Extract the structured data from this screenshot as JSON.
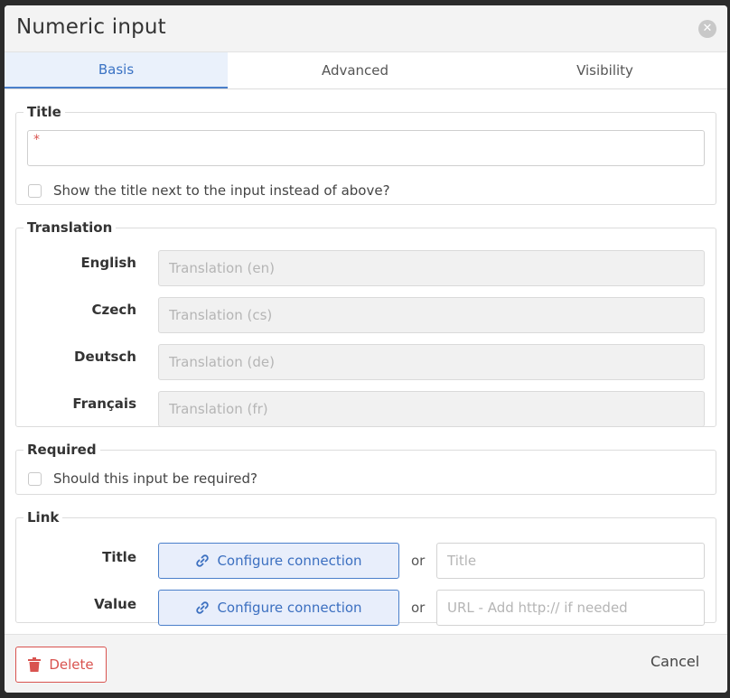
{
  "dialog": {
    "title": "Numeric input",
    "close_icon": "close-icon"
  },
  "tabs": [
    {
      "label": "Basis",
      "active": true
    },
    {
      "label": "Advanced",
      "active": false
    },
    {
      "label": "Visibility",
      "active": false
    }
  ],
  "title_section": {
    "legend": "Title",
    "required_marker": "*",
    "input_value": "",
    "checkbox_label": "Show the title next to the input instead of above?",
    "checked": false
  },
  "translation_section": {
    "legend": "Translation",
    "rows": [
      {
        "label": "English",
        "placeholder": "Translation (en)"
      },
      {
        "label": "Czech",
        "placeholder": "Translation (cs)"
      },
      {
        "label": "Deutsch",
        "placeholder": "Translation (de)"
      },
      {
        "label": "Français",
        "placeholder": "Translation (fr)"
      }
    ]
  },
  "required_section": {
    "legend": "Required",
    "checkbox_label": "Should this input be required?",
    "checked": false
  },
  "link_section": {
    "legend": "Link",
    "rows": [
      {
        "label": "Title",
        "button_label": "Configure connection",
        "or": "or",
        "placeholder": "Title"
      },
      {
        "label": "Value",
        "button_label": "Configure connection",
        "or": "or",
        "placeholder": "URL - Add http:// if needed"
      }
    ],
    "button_icon": "link-icon"
  },
  "footer": {
    "delete_label": "Delete",
    "delete_icon": "trash-icon",
    "cancel_label": "Cancel"
  },
  "colors": {
    "accent": "#4a7fca",
    "danger": "#d9534f",
    "active_tab_bg": "#eaf1fb"
  }
}
